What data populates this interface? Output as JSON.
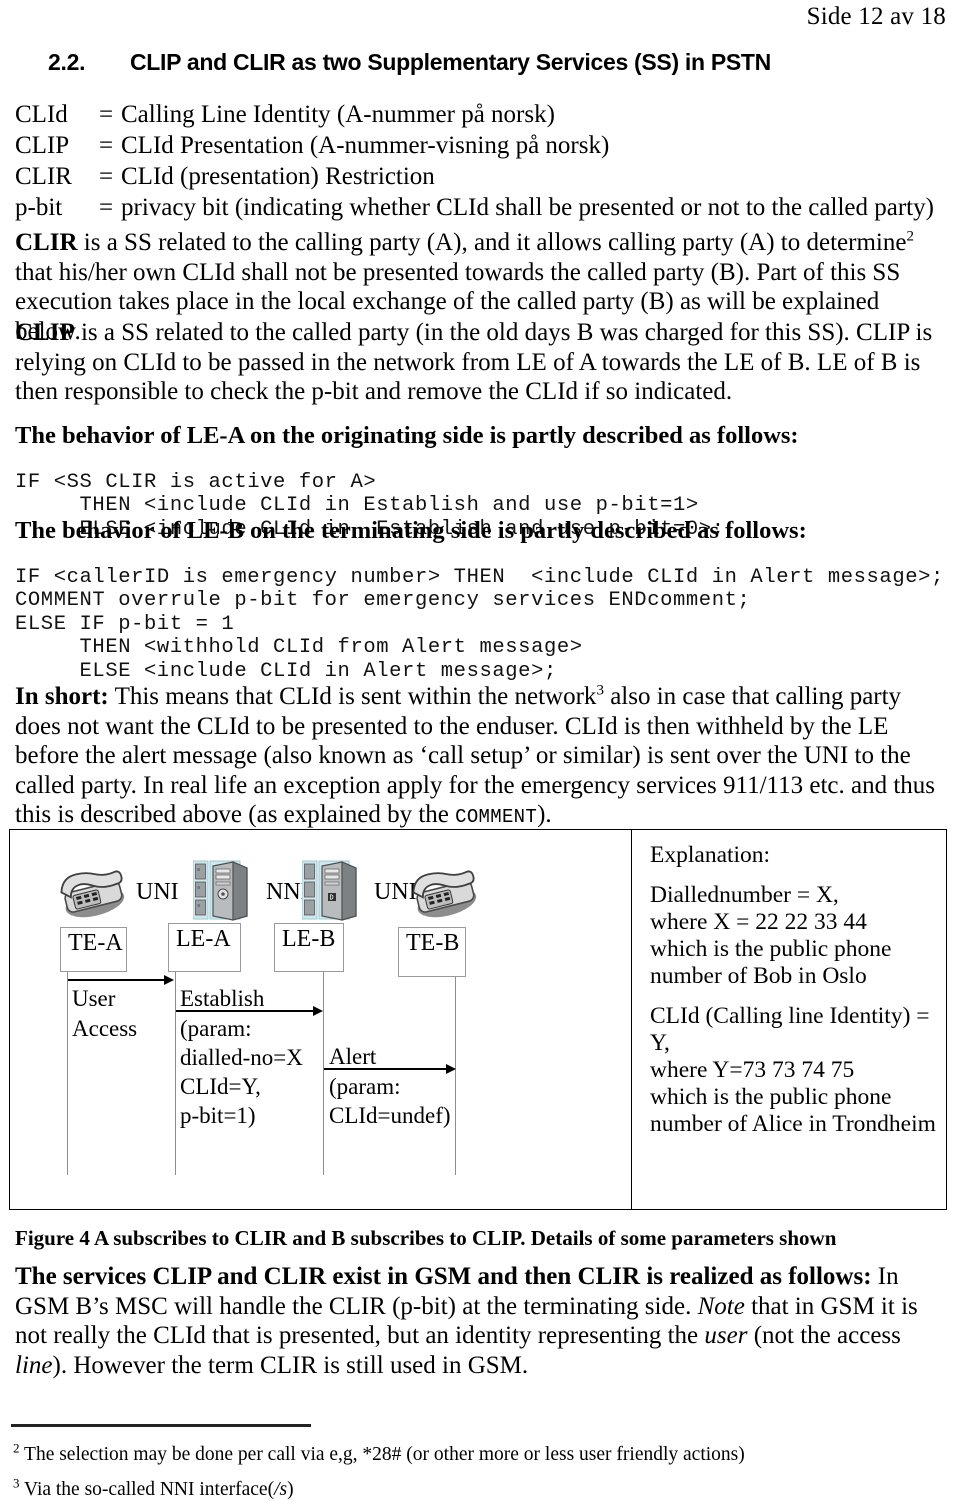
{
  "header": {
    "page_label": "Side 12 av 18"
  },
  "section": {
    "number": "2.2.",
    "title": "CLIP and CLIR as two Supplementary Services (SS) in PSTN"
  },
  "definitions": [
    {
      "term": "CLId",
      "eq": "=",
      "text": "Calling Line Identity (A-nummer på norsk)"
    },
    {
      "term": "CLIP",
      "eq": "=",
      "text": "CLId Presentation (A-nummer-visning på norsk)"
    },
    {
      "term": "CLIR",
      "eq": "=",
      "text": "CLId (presentation) Restriction"
    },
    {
      "term": "p-bit",
      "eq": "=",
      "text": "privacy bit (indicating whether CLId shall be presented or not to the called party)"
    }
  ],
  "paragraphs": {
    "clir_lead": "CLIR",
    "clir_text_a": " is a SS related to the calling party (A), and it allows calling party (A) to determine",
    "clir_sup": "2",
    "clir_text_b": " that his/her own CLId shall not be presented towards the called party (B). Part of this SS execution takes place in the local exchange of the called party (B) as will be explained below.",
    "clip_lead": "CLIP",
    "clip_text": " is a SS related to the called party (in the old days B was charged for this SS). CLIP is relying on CLId to be passed in the network from LE of A towards the LE of B. LE of B is then responsible to check the p-bit and remove the CLId if so indicated.",
    "le_a_heading": "The behavior of LE-A on the originating side is partly described as follows:",
    "le_b_heading": "The behavior of LE-B on the terminating side is partly described as follows:",
    "inshort_lead": "In short:",
    "inshort_text_a": " This means that CLId is sent within the network",
    "inshort_sup": "3",
    "inshort_text_b": " also in case that calling party does not want the CLId to be presented to the enduser. CLId is then withheld by the LE before the alert message (also known as ‘call setup’ or similar) is sent over the UNI to the called party. In real life an exception apply for the emergency services 911/113 etc. and thus this is described above (as explained by the ",
    "inshort_comment_token": "COMMENT",
    "inshort_text_c": ")."
  },
  "code_blocks": {
    "le_a": "IF <SS CLIR is active for A>\n     THEN <include CLId in Establish and use p-bit=1>\n     ELSE <include CLId in  Establish and use p-bit=0>;",
    "le_b": "IF <callerID is emergency number> THEN  <include CLId in Alert message>;\nCOMMENT overrule p-bit for emergency services ENDcomment;\nELSE IF p-bit = 1\n     THEN <withhold CLId from Alert message>\n     ELSE <include CLId in Alert message>;"
  },
  "figure": {
    "nodes": [
      {
        "id": "te-a",
        "label": "TE-A",
        "icon": "telephone-icon"
      },
      {
        "id": "le-a",
        "label": "LE-A",
        "icon": "server-tower-icon"
      },
      {
        "id": "le-b",
        "label": "LE-B",
        "icon": "server-tower-icon"
      },
      {
        "id": "te-b",
        "label": "TE-B",
        "icon": "telephone-icon"
      }
    ],
    "interfaces": [
      {
        "id": "uni-left",
        "label": "UNI"
      },
      {
        "id": "nni",
        "label": "NNI"
      },
      {
        "id": "uni-right",
        "label": "UNI"
      }
    ],
    "messages": [
      {
        "id": "user-access",
        "from": "te-a",
        "to": "le-a",
        "lines": [
          "User",
          "Access"
        ]
      },
      {
        "id": "establish",
        "from": "le-a",
        "to": "le-b",
        "lines": [
          "Establish",
          "(param:",
          "dialled-no=X",
          "CLId=Y,",
          "p-bit=1)"
        ]
      },
      {
        "id": "alert",
        "from": "le-b",
        "to": "te-b",
        "lines": [
          "Alert",
          "(param:",
          "CLId=undef)"
        ]
      }
    ],
    "explanation": {
      "title": "Explanation:",
      "block_1": [
        "Diallednumber = X,",
        "where X = 22 22 33 44",
        "which is the public phone",
        "number of Bob in Oslo"
      ],
      "block_2": [
        "CLId  (Calling line Identity) =",
        "Y,",
        "where Y=73 73 74 75",
        "which is the public phone",
        "number of Alice in Trondheim"
      ]
    },
    "caption": "Figure 4 A subscribes to CLIR and B subscribes to  CLIP. Details of some parameters shown"
  },
  "gsm_paragraph": {
    "lead": "The services CLIP and CLIR exist in GSM and then CLIR is realized as follows:",
    "text_a": " In GSM B’s MSC will handle the CLIR (p-bit) at the terminating side. ",
    "note_italic": "Note",
    "text_b": " that in GSM it is not really the CLId that is presented, but an identity representing the ",
    "user_italic": "user",
    "text_c": " (not the access ",
    "line_italic": "line",
    "text_d": "). However the term CLIR is still used in GSM."
  },
  "footnotes": [
    {
      "marker": "2",
      "text": "The selection may be done per call via e,g, *28# (or other more or less user friendly actions)"
    },
    {
      "marker": "3",
      "text_a": "Via the so-called NNI interface(",
      "italic": "/s",
      "text_b": ")"
    }
  ]
}
